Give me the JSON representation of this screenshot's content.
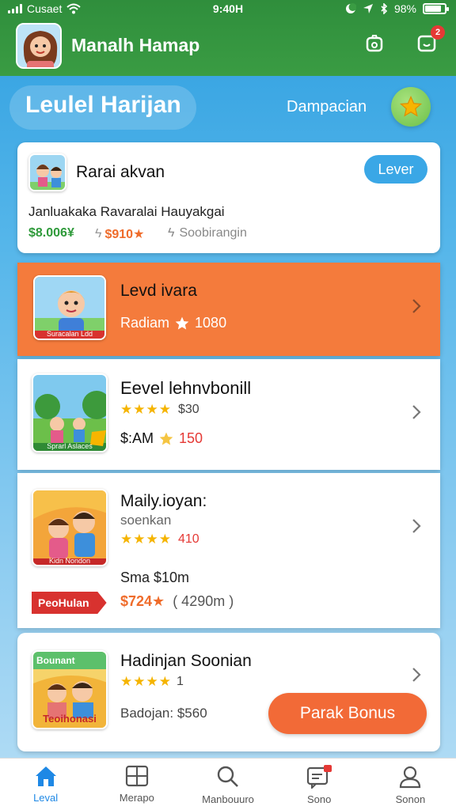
{
  "status_bar": {
    "carrier": "Cusaet",
    "time": "9:40H",
    "battery": "98%"
  },
  "header": {
    "title": "Manalh Hamap",
    "notification_count": "2"
  },
  "level_section": {
    "title": "Leulel Harijan",
    "side_label": "Dampacian"
  },
  "cards": [
    {
      "title": "Rarai akvan",
      "button": "Lever",
      "subtitle": "Janluakaka Ravaralai Hauyakgai",
      "price1": "$8.006¥",
      "price2": "$910★",
      "price3": "Soobirangin"
    },
    {
      "title": "Levd ivara",
      "meta_label": "Radiam",
      "meta_value": "1080",
      "thumb_caption": "Suracalan Ldd"
    },
    {
      "title": "Eevel lehnvbonill",
      "rating": "★★★★",
      "rating_value": "$30",
      "price_label": "$:AM",
      "price_value": "150",
      "thumb_caption": "Sprarl Aslaces"
    },
    {
      "title": "Maily.ioyan:",
      "subtitle": "soenkan",
      "rating": "★★★★",
      "rating_value": "410",
      "price_label": "Sma $10m",
      "tag": "PeoHulan",
      "price_value": "$724★",
      "price_extra": "( 4290m )",
      "thumb_caption": "Kidn Nondon"
    },
    {
      "title": "Hadinjan Soonian",
      "rating": "★★★★",
      "rating_value": "1",
      "price_label": "Badojan: $560",
      "button": "Parak Bonus",
      "thumb_top": "Bounant",
      "thumb_bottom": "Teoihonasi"
    }
  ],
  "bottom_nav": [
    {
      "label": "Leval",
      "icon": "home-icon"
    },
    {
      "label": "Merapo",
      "icon": "grid-icon"
    },
    {
      "label": "Manbouuro",
      "icon": "search-icon"
    },
    {
      "label": "Sono",
      "icon": "chat-icon"
    },
    {
      "label": "Sonon",
      "icon": "profile-icon"
    }
  ],
  "colors": {
    "header_green": "#3a9c43",
    "accent_orange": "#f26a37",
    "accent_blue": "#3aa7e6",
    "star": "#f5b400"
  }
}
